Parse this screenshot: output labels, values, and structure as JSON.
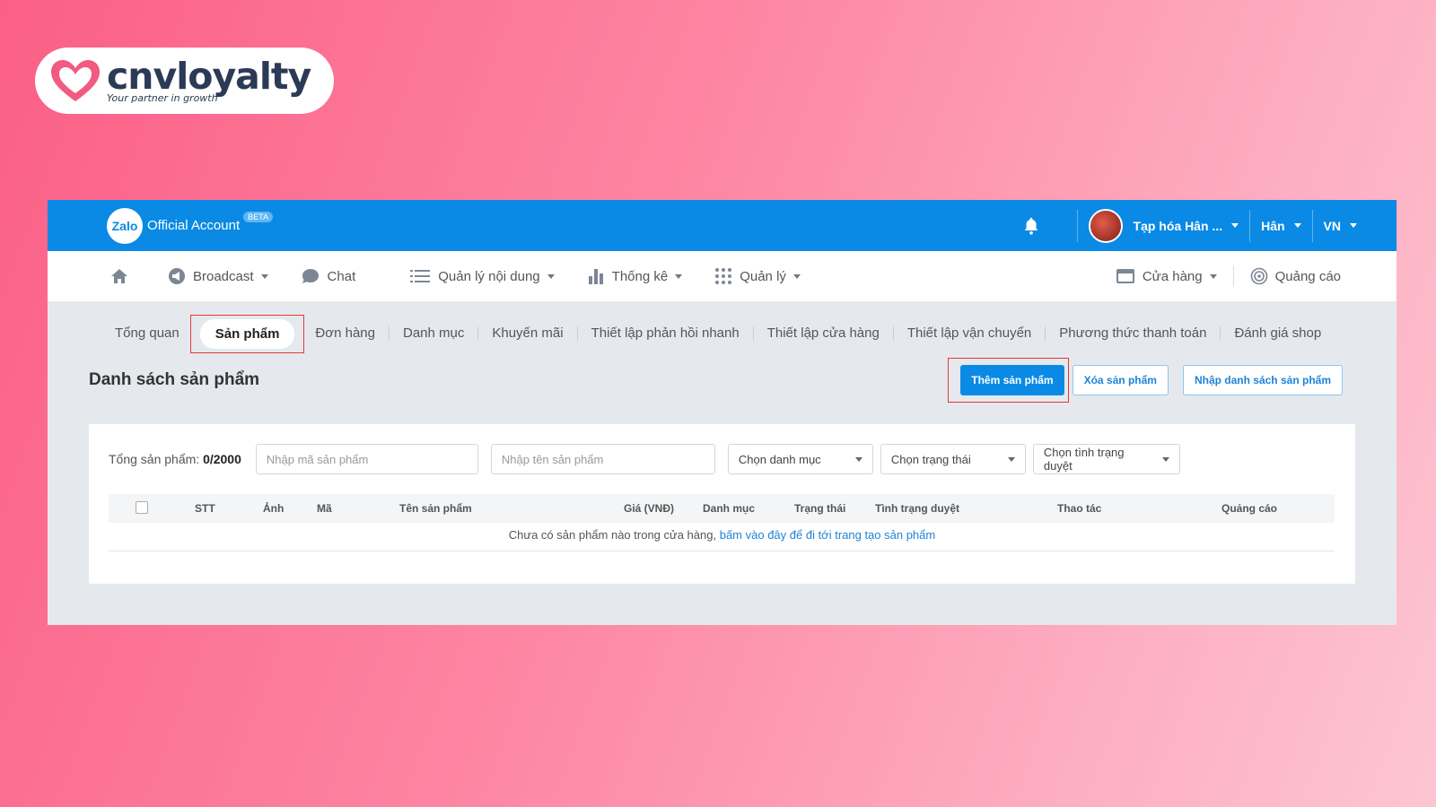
{
  "logo": {
    "name": "cnvloyalty",
    "tagline": "Your partner in growth",
    "heart_color": "#f25a80"
  },
  "topbar": {
    "zalo_logo": "Zalo",
    "title": "Official Account",
    "badge": "BETA",
    "shop_name": "Tạp hóa Hân ...",
    "user": "Hân",
    "lang": "VN",
    "icons": {
      "bell": "bell-icon",
      "avatar": "avatar"
    },
    "bg_color": "#0a8ae5"
  },
  "menu": {
    "items": [
      {
        "label": "Broadcast",
        "icon": "megaphone-icon"
      },
      {
        "label": "Chat",
        "icon": "chat-bubble-icon"
      },
      {
        "label": "Quản lý nội dung",
        "icon": "list-icon"
      },
      {
        "label": "Thống kê",
        "icon": "bar-chart-icon"
      },
      {
        "label": "Quản lý",
        "icon": "grid-dots-icon"
      }
    ],
    "right": [
      {
        "label": "Cửa hàng",
        "icon": "store-icon"
      },
      {
        "label": "Quảng cáo",
        "icon": "target-icon"
      }
    ]
  },
  "subnav": {
    "items": [
      "Tổng quan",
      "Sản phẩm",
      "Đơn hàng",
      "Danh mục",
      "Khuyến mãi",
      "Thiết lập phản hồi nhanh",
      "Thiết lập cửa hàng",
      "Thiết lập vận chuyển",
      "Phương thức thanh toán",
      "Đánh giá shop"
    ],
    "active_index": 1
  },
  "page": {
    "title": "Danh sách sản phẩm",
    "buttons": {
      "add": "Thêm sản phẩm",
      "delete": "Xóa sản phẩm",
      "import": "Nhập danh sách sản phẩm"
    }
  },
  "filters": {
    "total_label": "Tổng sản phẩm:",
    "total_value": "0/2000",
    "code_placeholder": "Nhập mã sản phẩm",
    "name_placeholder": "Nhập tên sản phẩm",
    "category": "Chọn danh mục",
    "status": "Chọn trạng thái",
    "review_status": "Chọn tình trạng duyệt"
  },
  "table": {
    "columns": [
      "STT",
      "Ảnh",
      "Mã",
      "Tên sản phẩm",
      "Giá (VNĐ)",
      "Danh mục",
      "Trạng thái",
      "Tình trạng duyệt",
      "Thao tác",
      "Quảng cáo"
    ],
    "empty_text": "Chưa có sản phẩm nào trong cửa hàng,",
    "empty_link": "bấm vào đây để đi tới trang tạo sản phẩm"
  }
}
